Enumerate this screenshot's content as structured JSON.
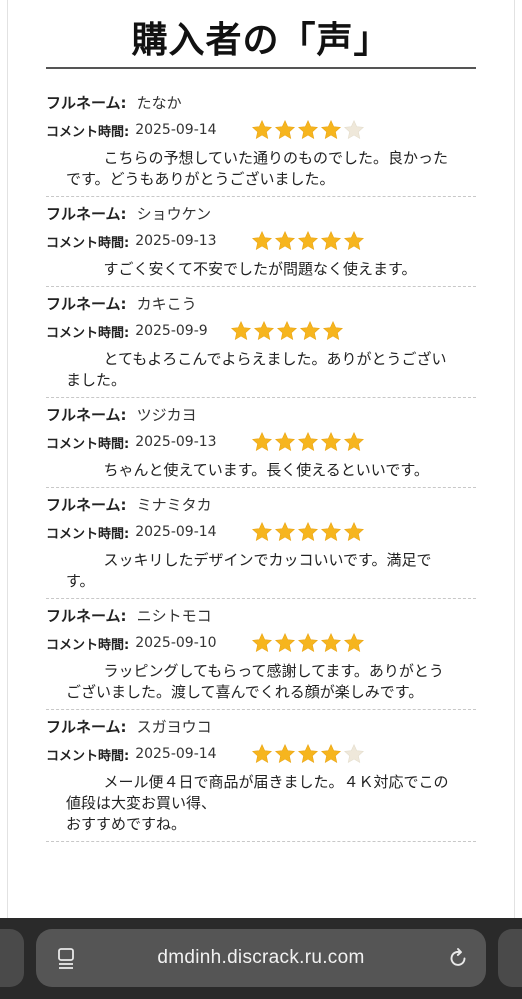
{
  "page": {
    "title": "購入者の「声」",
    "name_label": "フルネーム:",
    "time_label": "コメント時間:"
  },
  "reviews": [
    {
      "name": "たなか",
      "date": "2025-09-14",
      "rating": 4,
      "comment": "こちらの予想していた通りのものでした。良かったです。どうもありがとうございました。"
    },
    {
      "name": "ショウケン",
      "date": "2025-09-13",
      "rating": 5,
      "comment": "すごく安くて不安でしたが問題なく使えます。"
    },
    {
      "name": "カキこう",
      "date": "2025-09-9",
      "rating": 5,
      "comment": "とてもよろこんでよらえました。ありがとうございました。"
    },
    {
      "name": "ツジカヨ",
      "date": "2025-09-13",
      "rating": 5,
      "comment": "ちゃんと使えています。長く使えるといいです。"
    },
    {
      "name": "ミナミタカ",
      "date": "2025-09-14",
      "rating": 5,
      "comment": "スッキリしたデザインでカッコいいです。満足です。"
    },
    {
      "name": "ニシトモコ",
      "date": "2025-09-10",
      "rating": 5,
      "comment": "ラッピングしてもらって感謝してます。ありがとうございました。渡して喜んでくれる顔が楽しみです。"
    },
    {
      "name": "スガヨウコ",
      "date": "2025-09-14",
      "rating": 4,
      "comment": "メール便４日で商品が届きました。４Ｋ対応でこの値段は大変お買い得、\nおすすめですね。"
    }
  ],
  "browser": {
    "url": "dmdinh.discrack.ru.com",
    "page_icon": "page-menu-icon",
    "reload_icon": "reload-icon"
  },
  "colors": {
    "star_filled": "#F6B51E",
    "star_empty": "#EFE8DA",
    "toolbar_bg": "#2A2A2A",
    "address_bg": "#555555"
  }
}
